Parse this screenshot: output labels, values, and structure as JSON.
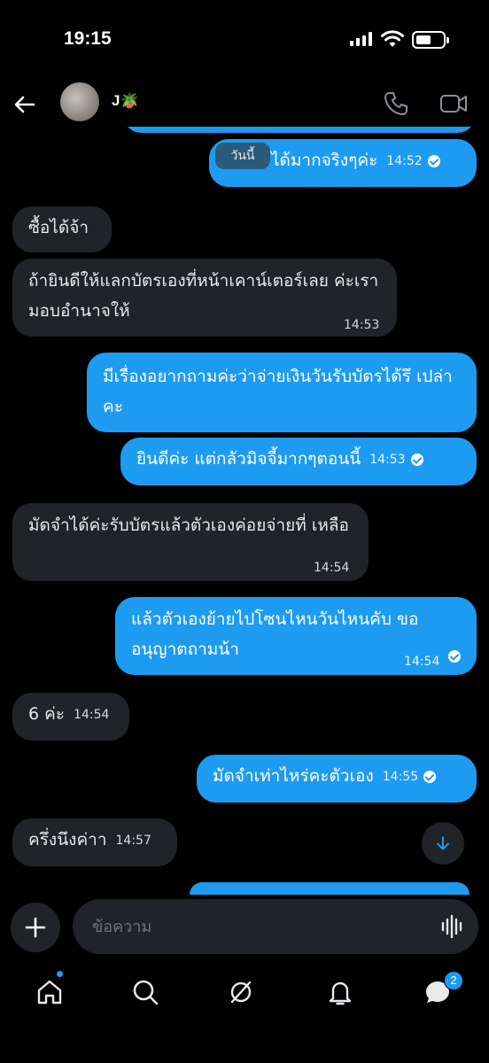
{
  "status_bar": {
    "time": "19:15"
  },
  "header": {
    "contact_name": "J🪴"
  },
  "date_separator": "วันนี้",
  "messages": [
    {
      "dir": "out",
      "text": "ได้มากจริงๆค่ะ",
      "time": "14:52",
      "read": true
    },
    {
      "dir": "in",
      "text": "ซื้อได้จ้า",
      "time": ""
    },
    {
      "dir": "in",
      "text": "ถ้ายินดีให้แลกบัตรเองที่หน้าเคาน์เตอร์เลย ค่ะเรามอบอำนาจให้",
      "time": "14:53"
    },
    {
      "dir": "out",
      "text": "มีเรื่องอยากถามค่ะว่าจ่ายเงินวันรับบัตรได้รึ เปล่าคะ",
      "time": ""
    },
    {
      "dir": "out",
      "text": "ยินดีค่ะ แต่กลัวมิจจี้มากๆตอนนี้",
      "time": "14:53",
      "read": true
    },
    {
      "dir": "in",
      "text": "มัดจำได้ค่ะรับบัตรแล้วตัวเองค่อยจ่ายที่ เหลือ",
      "time": "14:54"
    },
    {
      "dir": "out",
      "text": "แล้วตัวเองย้ายไปโซนไหนวันไหนคับ ขอ อนุญาตถามน้า",
      "time": "14:54",
      "read": true
    },
    {
      "dir": "in",
      "text": "6 ค่ะ",
      "time": "14:54"
    },
    {
      "dir": "out",
      "text": "มัดจำเท่าไหร่คะตัวเอง",
      "time": "14:55",
      "read": true
    },
    {
      "dir": "in",
      "text": "ครึ่งนึงค่าา",
      "time": "14:57"
    }
  ],
  "composer": {
    "placeholder": "ข้อความ"
  },
  "nav": {
    "messages_badge": "2"
  }
}
